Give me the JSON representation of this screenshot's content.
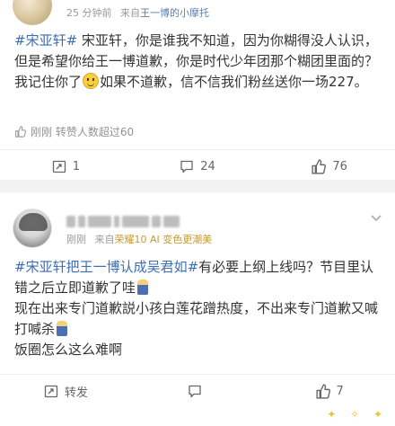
{
  "post1": {
    "time": "25 分钟前",
    "source_prefix": "来自",
    "source_name": "王一博的小摩托",
    "tag": "#宋亚轩#",
    "text_before_emoji": " 宋亚轩，你是谁我不知道，因为你糊得没人认识，但是希望你给王一博道歉，你是时代少年团那个糊团里面的？我记住你了",
    "text_after_emoji": "如果不道歉，信不信我们粉丝送你一场227。",
    "repost_note": "刚刚  转赞人数超过60",
    "actions": {
      "repost": "1",
      "comment": "24",
      "like": "76"
    }
  },
  "post2": {
    "time": "刚刚",
    "source_prefix": "来自",
    "source_name": "荣耀10 AI 变色更潮美",
    "tag": "#宋亚轩把王一博认成吴君如#",
    "line1_rest": "有必要上纲上线吗？节目里认错之后立即道歉了哇",
    "line2": "现在出来专门道歉説小孩白莲花蹭热度，不出来专门道歉又喊打喊杀",
    "line3": "饭圈怎么这么难啊",
    "actions": {
      "repost": "转发",
      "comment": "",
      "like": "7"
    }
  },
  "icons": {
    "repost": "repost-icon",
    "comment": "comment-icon",
    "like": "like-icon",
    "chevron": "chevron-down-icon"
  },
  "colors": {
    "tag": "#3c6eb4",
    "meta": "#999999",
    "source_link": "#5b7fb0",
    "vip": "#e8a33c",
    "gap": "#f2f2f2"
  }
}
